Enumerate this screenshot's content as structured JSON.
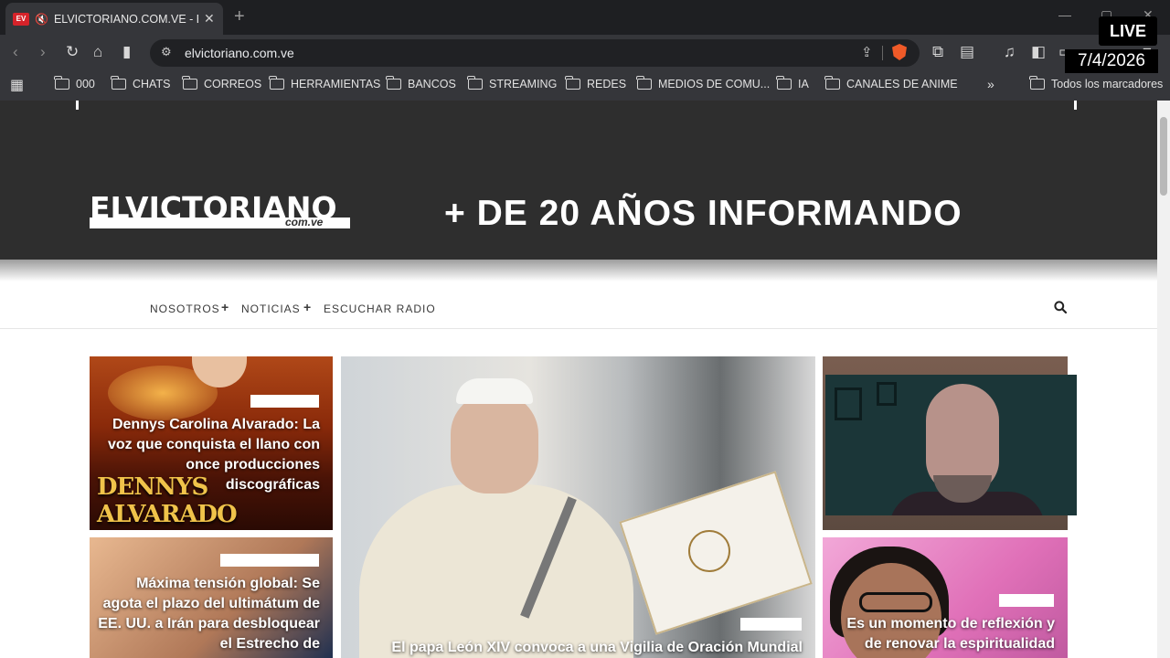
{
  "browser": {
    "tab_title": "ELVICTORIANO.COM.VE - El p",
    "favicon_text": "EV",
    "url": "elvictoriano.com.ve",
    "bookmarks": [
      {
        "label": "000"
      },
      {
        "label": "CHATS"
      },
      {
        "label": "CORREOS"
      },
      {
        "label": "HERRAMIENTAS"
      },
      {
        "label": "BANCOS"
      },
      {
        "label": "STREAMING"
      },
      {
        "label": "REDES"
      },
      {
        "label": "MEDIOS DE COMU..."
      },
      {
        "label": "IA"
      },
      {
        "label": "CANALES DE ANIME"
      }
    ],
    "overflow_label": "»",
    "all_bookmarks": "Todos los marcadores"
  },
  "overlay": {
    "live": "LIVE",
    "date": "7/4/2026"
  },
  "site": {
    "logo": "ELVICTORIANO",
    "logo_sub": "com.ve",
    "slogan": "+ DE 20 AÑOS INFORMANDO",
    "nav": {
      "nosotros": "NOSOTROS",
      "noticias": "NOTICIAS",
      "radio": "ESCUCHAR RADIO",
      "plus": "+"
    }
  },
  "cards": {
    "c1_title": "Dennys Carolina Alvarado: La voz que conquista el llano con once producciones discográficas",
    "c1_brand": "DENNYS ALVARADO",
    "c2_title": "El papa León XIV convoca a una Vigilia de Oración Mundial",
    "c4_title": "Máxima tensión global: Se agota el plazo del ultimátum de EE. UU. a Irán para desbloquear el Estrecho de",
    "c5_title": "Es un momento de reflexión y de renovar la espiritualidad"
  },
  "colors": {
    "hero_bg": "#2e2e2e",
    "chrome_dark": "#35363a",
    "brave": "#f05a28",
    "favicon": "#d6232a"
  }
}
